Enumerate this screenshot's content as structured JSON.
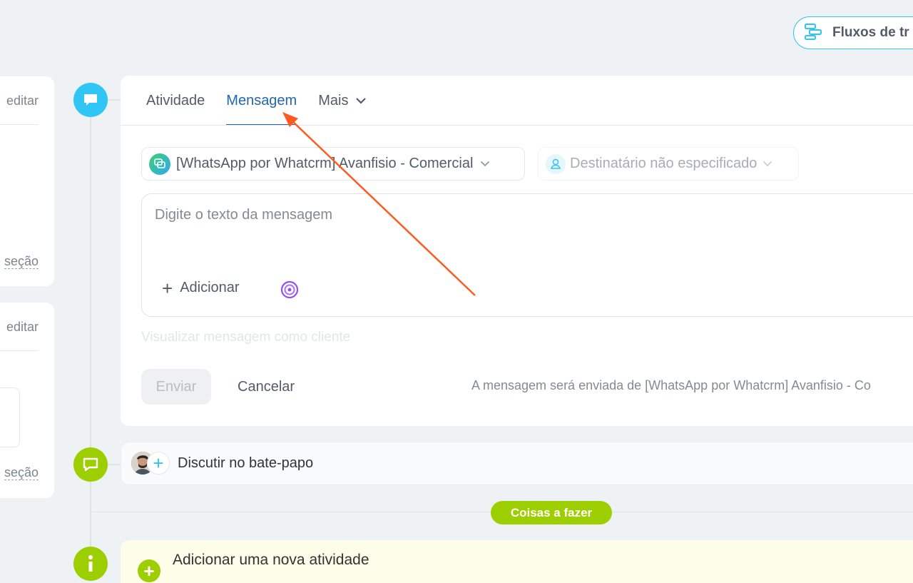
{
  "header": {
    "flows_label": "Fluxos de tr"
  },
  "left_panels": [
    {
      "edit_label": "editar",
      "section_label": "seção"
    },
    {
      "edit_label": "editar",
      "section_label": "seção"
    }
  ],
  "tabs": [
    {
      "label": "Atividade"
    },
    {
      "label": "Mensagem"
    },
    {
      "label": "Mais"
    }
  ],
  "composer": {
    "channel": "[WhatsApp por Whatcrm] Avanfisio - Comercial",
    "recipient": "Destinatário não especificado",
    "message_placeholder": "Digite o texto da mensagem",
    "add_label": "Adicionar",
    "preview_label": "Visualizar mensagem como cliente",
    "send_label": "Enviar",
    "cancel_label": "Cancelar",
    "hint": "A mensagem será enviada de [WhatsApp por Whatcrm] Avanfisio - Co"
  },
  "discuss": {
    "label": "Discutir no bate-papo"
  },
  "todo": {
    "badge": "Coisas a fazer"
  },
  "new_activity": {
    "label": "Adicionar uma nova atividade"
  },
  "colors": {
    "accent_blue": "#2fc6f6",
    "active_tab": "#2067b0",
    "green": "#9dcf00",
    "annotation": "#ff5a1f"
  }
}
